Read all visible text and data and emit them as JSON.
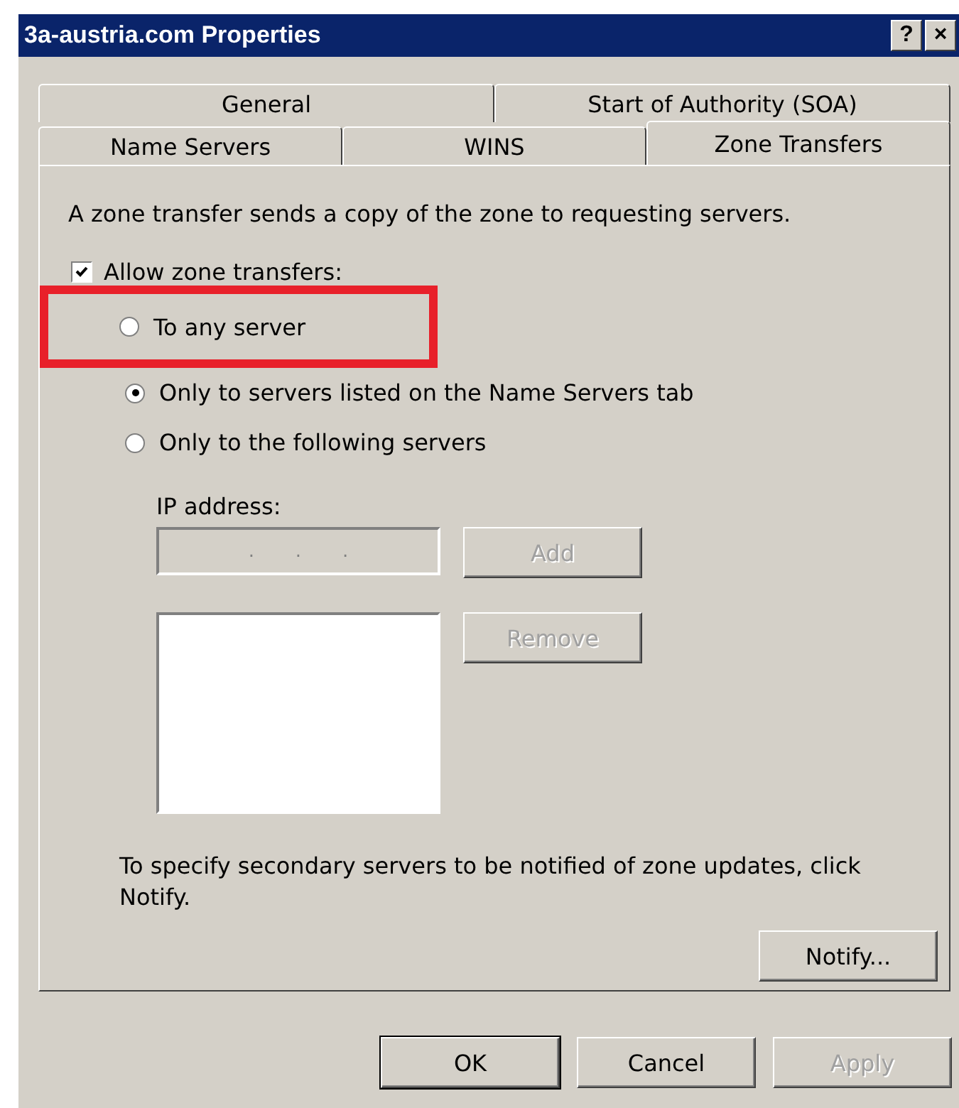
{
  "window": {
    "title": "3a-austria.com Properties",
    "title_buttons": [
      "?",
      "×"
    ]
  },
  "tab_rows": [
    [
      {
        "label": "General",
        "selected": false
      },
      {
        "label": "Start of Authority (SOA)",
        "selected": false
      }
    ],
    [
      {
        "label": "Name Servers",
        "selected": false
      },
      {
        "label": "WINS",
        "selected": false
      },
      {
        "label": "Zone Transfers",
        "selected": true
      }
    ]
  ],
  "description": "A zone transfer sends a copy of the zone to requesting servers.",
  "allow_transfers": {
    "label": "Allow zone transfers:",
    "checked": true
  },
  "options": [
    {
      "label": "To any server",
      "selected": false,
      "highlighted": true
    },
    {
      "label": "Only to servers listed on the Name Servers tab",
      "selected": true,
      "highlighted": false
    },
    {
      "label": "Only to the following servers",
      "selected": false,
      "highlighted": false
    }
  ],
  "ip_address": {
    "label": "IP address:",
    "value": ".       .       .",
    "disabled": true
  },
  "add_button": {
    "label": "Add",
    "disabled": true
  },
  "remove_button": {
    "label": "Remove",
    "disabled": true
  },
  "notify_note": "To specify secondary servers to be notified of zone updates, click Notify.",
  "notify_button": {
    "label": "Notify...",
    "disabled": false
  },
  "buttons": [
    {
      "label": "OK",
      "disabled": false,
      "default": true
    },
    {
      "label": "Cancel",
      "disabled": false,
      "default": false
    },
    {
      "label": "Apply",
      "disabled": true,
      "default": false
    }
  ]
}
